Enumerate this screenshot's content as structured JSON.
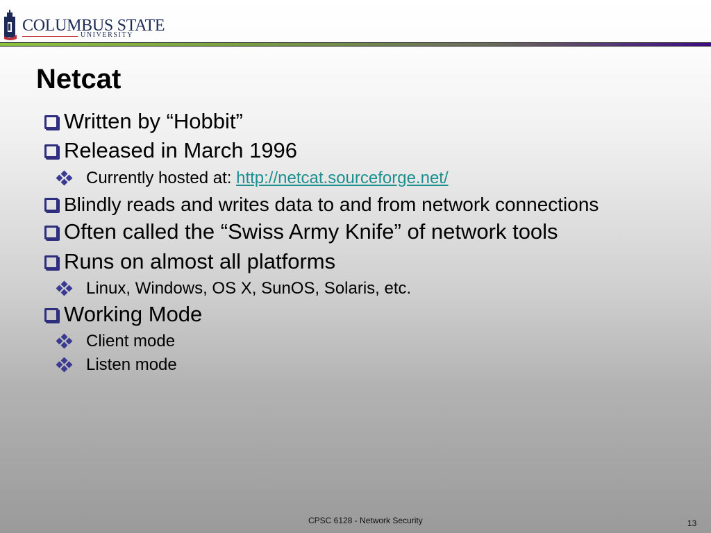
{
  "header": {
    "logo_main": "COLUMBUS STATE",
    "logo_sub": "UNIVERSITY",
    "brand_colors": {
      "navy": "#1d2a57",
      "red": "#c0323a",
      "bar_start": "#8cc43c",
      "bar_end": "#3e0a86"
    }
  },
  "slide": {
    "title": "Netcat",
    "bullets": [
      {
        "level": 1,
        "icon": "checkbox-square-icon",
        "text": "Written by “Hobbit”"
      },
      {
        "level": 1,
        "icon": "checkbox-square-icon",
        "text": "Released in March 1996"
      },
      {
        "level": 2,
        "icon": "diamond-bullet-icon",
        "text": "Currently hosted at: ",
        "link": "http://netcat.sourceforge.net/"
      },
      {
        "level": 1,
        "icon": "checkbox-square-icon",
        "text": "Blindly reads and writes data to and from network connections"
      },
      {
        "level": 1,
        "icon": "checkbox-square-icon",
        "text": "Often called the “Swiss Army Knife” of network tools"
      },
      {
        "level": 1,
        "icon": "checkbox-square-icon",
        "text": "Runs on almost all platforms"
      },
      {
        "level": 2,
        "icon": "diamond-bullet-icon",
        "text": "Linux, Windows, OS X, SunOS, Solaris, etc."
      },
      {
        "level": 1,
        "icon": "checkbox-square-icon",
        "text": "Working Mode"
      },
      {
        "level": 2,
        "icon": "diamond-bullet-icon",
        "text": "Client mode"
      },
      {
        "level": 2,
        "icon": "diamond-bullet-icon",
        "text": "Listen mode"
      }
    ],
    "link_color": "#1d8f8f",
    "bullet_color": "#2e2e7c"
  },
  "footer": {
    "course": "CPSC 6128 - Network Security",
    "page_number": "13"
  }
}
